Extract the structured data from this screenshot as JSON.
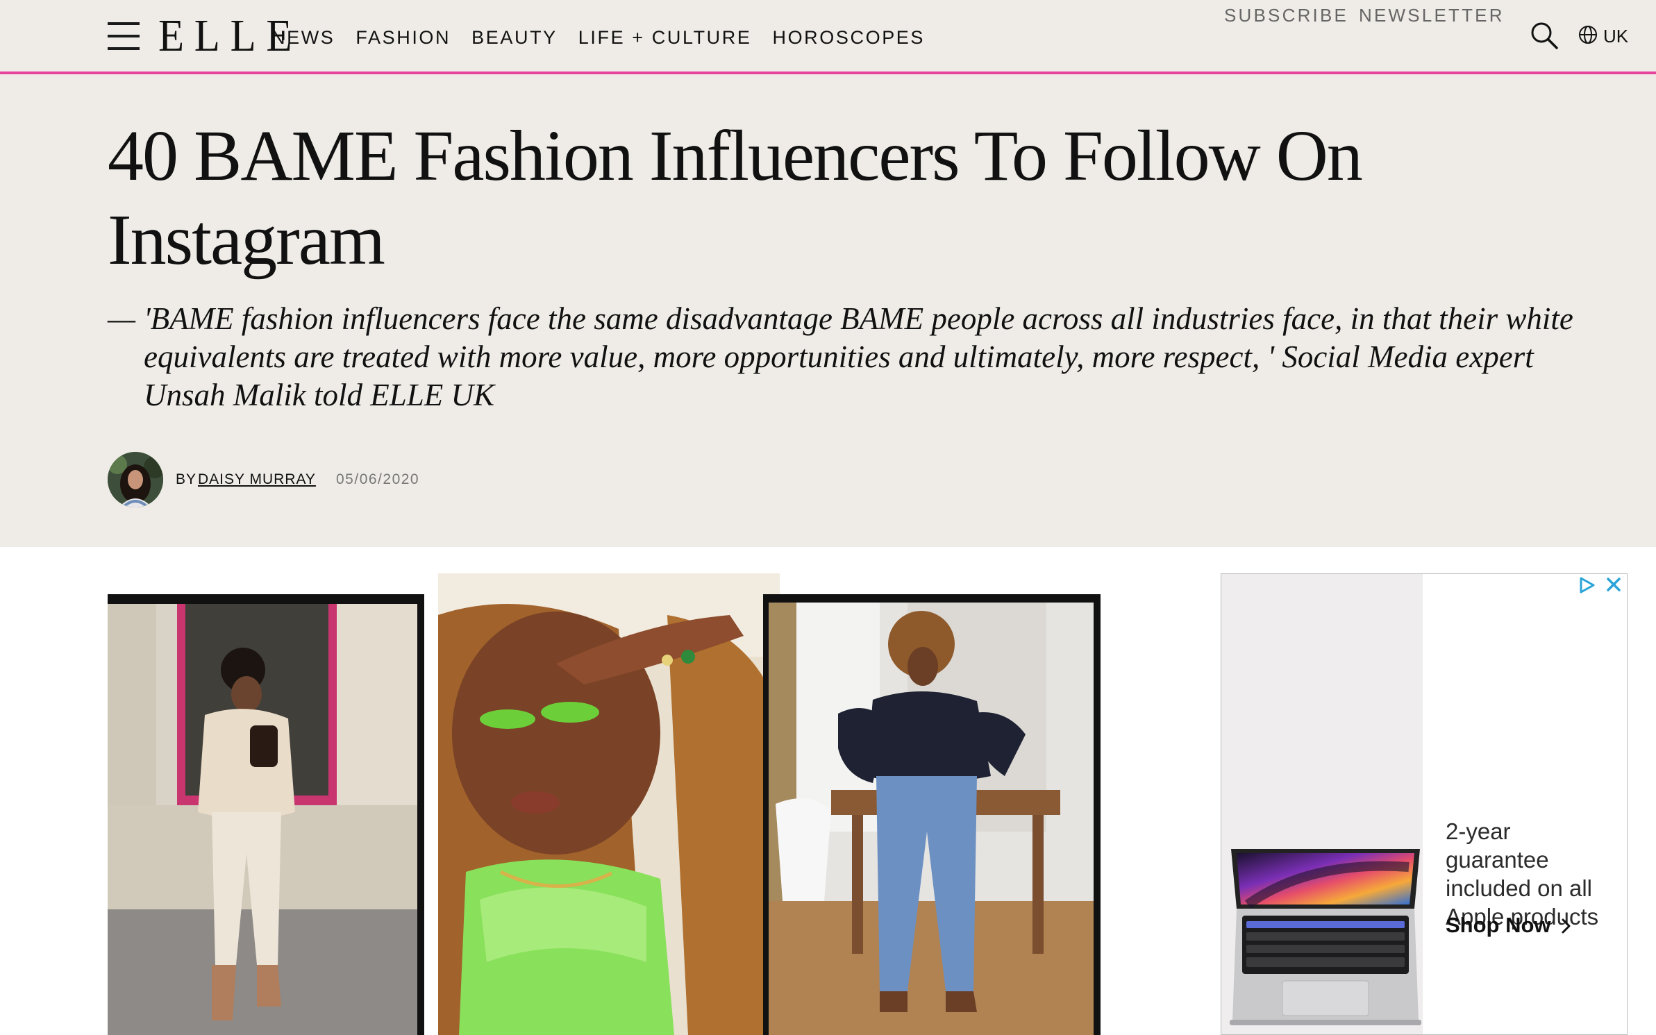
{
  "header": {
    "logo": "ELLE",
    "nav": [
      {
        "label": "NEWS"
      },
      {
        "label": "FASHION"
      },
      {
        "label": "BEAUTY"
      },
      {
        "label": "LIFE + CULTURE"
      },
      {
        "label": "HOROSCOPES"
      }
    ],
    "subscribe_label": "SUBSCRIBE",
    "newsletter_label": "NEWSLETTER",
    "region_label": "UK",
    "icons": {
      "menu": "hamburger-menu-icon",
      "search": "search-icon",
      "region": "globe-icon"
    },
    "accent_color": "#e6449c"
  },
  "article": {
    "title": "40 BAME Fashion Influencers To Follow On Instagram",
    "dek_dash": "—",
    "dek": "'BAME fashion influencers face the same disadvantage BAME people across all industries face, in that their white equivalents are treated with more value, more opportunities and ultimately, more respect, ' Social Media expert Unsah Malik told ELLE UK",
    "byline_prefix": "BY",
    "author": "DAISY MURRAY",
    "date": "05/06/2020"
  },
  "ad": {
    "copy": "2-year guarantee included on all Apple products",
    "cta": "Shop Now",
    "cta_icon": "chevron-right-icon",
    "choices_icon": "adchoices-icon",
    "close_icon": "close-icon"
  },
  "colors": {
    "hero_bg": "#efece7",
    "ad_choices": "#2aa4d8"
  }
}
